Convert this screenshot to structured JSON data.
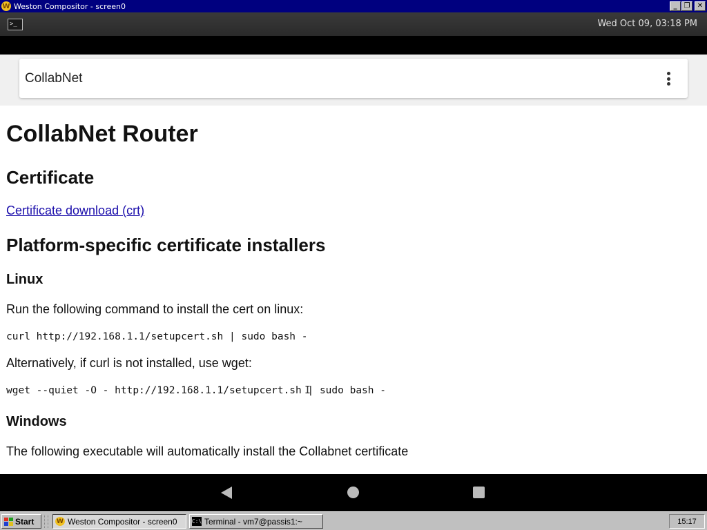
{
  "window": {
    "title": "Weston Compositor - screen0",
    "icon": "weston-icon",
    "icon_glyph": "W",
    "minimize_glyph": "_",
    "maximize_glyph": "❐",
    "close_glyph": "✕"
  },
  "weston_panel": {
    "launcher_icon": "terminal-icon",
    "launcher_glyph": ">_",
    "clock": "Wed Oct 09, 03:18 PM"
  },
  "browser": {
    "appbar_title": "CollabNet",
    "menu_icon": "more-vert-icon"
  },
  "content": {
    "h1": "CollabNet Router",
    "cert_heading": "Certificate",
    "cert_link": "Certificate download (crt)",
    "installers_heading": "Platform-specific certificate installers",
    "linux_heading": "Linux",
    "linux_text": "Run the following command to install the cert on linux:",
    "linux_cmd_curl": "curl http://192.168.1.1/setupcert.sh | sudo bash -",
    "alt_text": "Alternatively, if curl is not installed, use wget:",
    "linux_cmd_wget": "wget --quiet -O - http://192.168.1.1/setupcert.sh | sudo bash -",
    "text_cursor_glyph": "I",
    "windows_heading": "Windows",
    "windows_text": "The following executable will automatically install the Collabnet certificate"
  },
  "android_nav": {
    "back_icon": "back-triangle-icon",
    "home_icon": "home-circle-icon",
    "recents_icon": "recents-square-icon"
  },
  "taskbar": {
    "start_label": "Start",
    "tasks": [
      {
        "label": "Weston Compositor - screen0",
        "icon": "weston-icon",
        "icon_glyph": "W",
        "active": true
      },
      {
        "label": "Terminal - vm7@passis1:~",
        "icon": "terminal-icon",
        "icon_glyph": "C:\\",
        "active": false
      }
    ],
    "clock": "15:17"
  }
}
